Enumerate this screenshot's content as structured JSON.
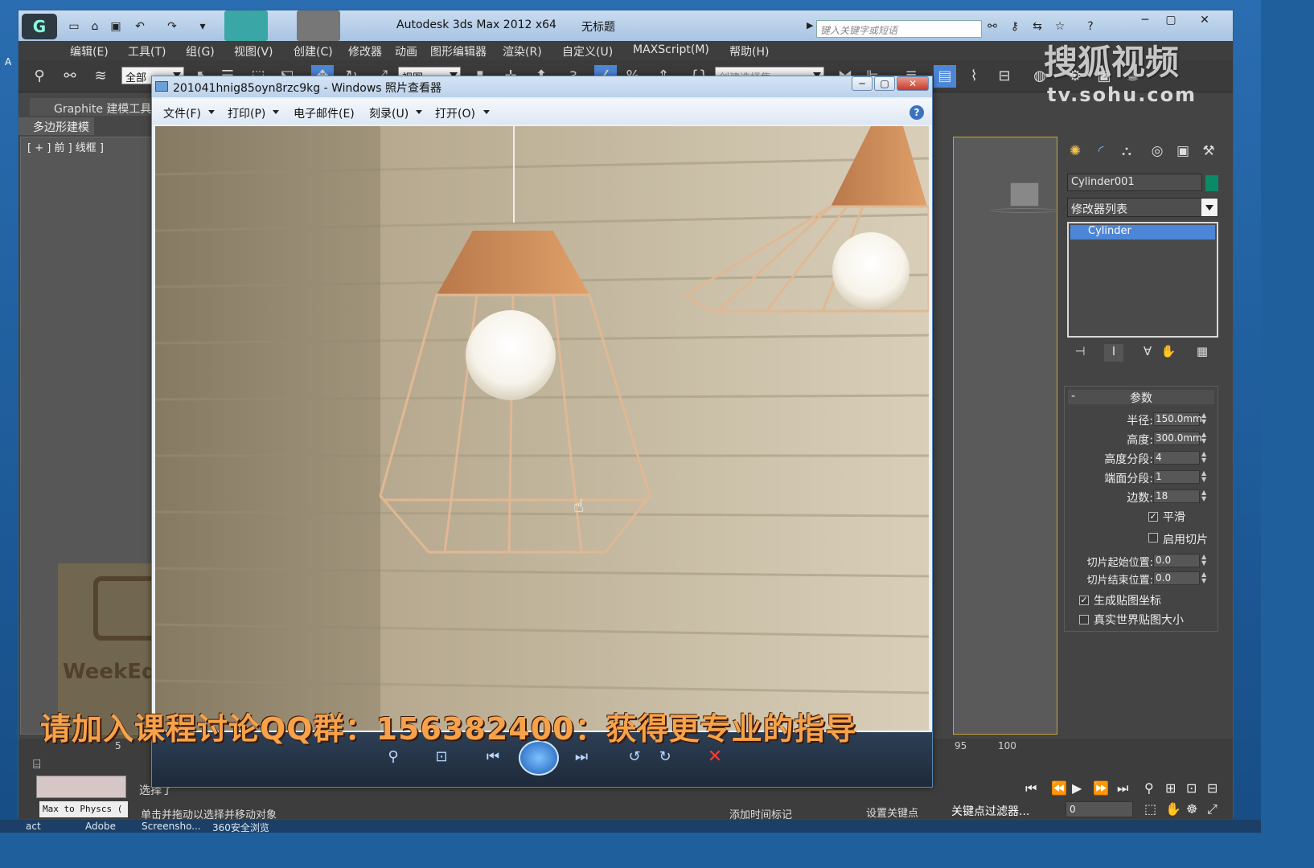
{
  "desktop": {
    "left_char": "A"
  },
  "max_window": {
    "app_title": "Autodesk 3ds Max  2012 x64",
    "doc_title": "无标题",
    "search_placeholder": "键入关键字或短语",
    "menu": [
      "编辑(E)",
      "工具(T)",
      "组(G)",
      "视图(V)",
      "创建(C)",
      "修改器",
      "动画",
      "图形编辑器",
      "渲染(R)",
      "自定义(U)",
      "MAXScript(M)",
      "帮助(H)"
    ],
    "toolbar": {
      "filter": "全部",
      "ref_coord": "视图",
      "snap_num": "3",
      "selection_set": "创建选择集"
    },
    "ribbon": {
      "graphite": "Graphite 建模工具",
      "poly": "多边形建模"
    },
    "viewport_label": "[ + ] 前 ] 线框 ]",
    "command_panel": {
      "object_name": "Cylinder001",
      "object_color": "#0a8a66",
      "modifier_list": "修改器列表",
      "stack_item": "Cylinder",
      "params_title": "参数",
      "params": [
        {
          "label": "半径:",
          "value": "150.0mm"
        },
        {
          "label": "高度:",
          "value": "300.0mm"
        },
        {
          "label": "高度分段:",
          "value": "4"
        },
        {
          "label": "端面分段:",
          "value": "1"
        },
        {
          "label": "边数:",
          "value": "18"
        }
      ],
      "smooth": {
        "label": "平滑",
        "checked": true
      },
      "slice_on": {
        "label": "启用切片",
        "checked": false
      },
      "slice_from": {
        "label": "切片起始位置:",
        "value": "0.0"
      },
      "slice_to": {
        "label": "切片结束位置:",
        "value": "0.0"
      },
      "gen_map": {
        "label": "生成贴图坐标",
        "checked": true
      },
      "real_world": {
        "label": "真实世界贴图大小",
        "checked": false
      }
    },
    "timeline": {
      "n5": "5",
      "n95": "95",
      "n100": "100"
    },
    "status": {
      "selected": "选择了",
      "maxphysx": "Max to Physcs (",
      "hint": "单击并拖动以选择并移动对象",
      "add_time_tag": "添加时间标记",
      "set_keys": "设置关键点",
      "key_filters": "关键点过滤器...",
      "frame": "0"
    }
  },
  "photo_viewer": {
    "title": "201041hnig85oyn8rzc9kg - Windows 照片查看器",
    "menu": [
      "文件(F)",
      "打印(P)",
      "电子邮件(E)",
      "刻录(U)",
      "打开(O)"
    ]
  },
  "overlay": {
    "subtitle": "请加入课程讨论QQ群：156382400：获得更专业的指导",
    "sohu": "搜狐视频",
    "sohu_url": "tv.sohu.com",
    "weekedu": "WeekEdu"
  },
  "taskbar": [
    "act",
    "Adobe",
    "Screensho...",
    "360安全浏览"
  ]
}
